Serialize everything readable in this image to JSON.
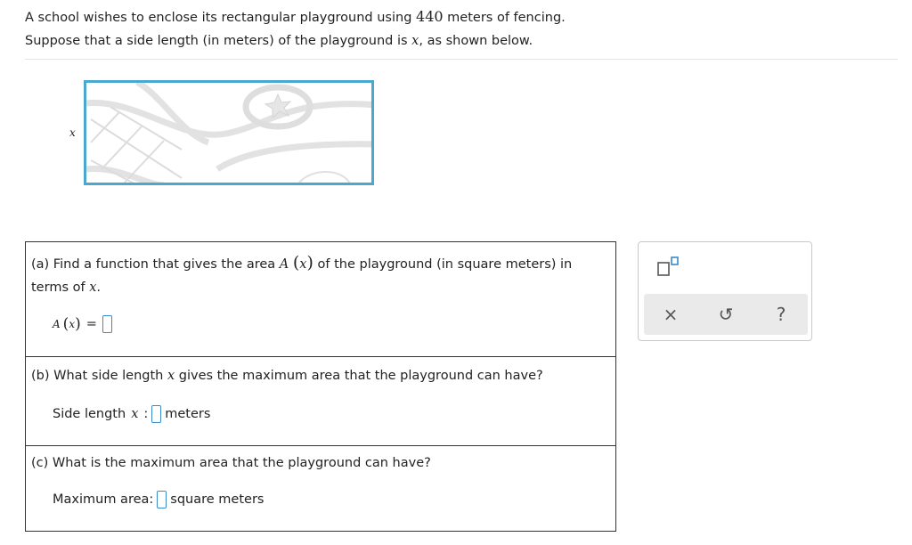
{
  "intro": {
    "line1_a": "A school wishes to enclose its rectangular playground using",
    "fencing_length": "440",
    "line1_b": "meters of fencing.",
    "line2_a": "Suppose that a side length (in meters) of the playground is",
    "var_x": "x",
    "line2_b": ", as shown below."
  },
  "figure": {
    "side_label": "x"
  },
  "part_a": {
    "q_a": "(a) Find a function that gives the area",
    "func": "A",
    "paren_open": "(",
    "var": "x",
    "paren_close": ")",
    "q_b": "of the playground (in square meters) in",
    "q_c": "terms of",
    "var2": "x",
    "period": ".",
    "ans_func": "A",
    "ans_var": "x",
    "equals": "="
  },
  "part_b": {
    "q_a": "(b) What side length",
    "var": "x",
    "q_b": "gives the maximum area that the playground can have?",
    "ans_label": "Side length",
    "ans_var": "x",
    "colon": ":",
    "unit": "meters"
  },
  "part_c": {
    "question": "(c) What is the maximum area that the playground can have?",
    "ans_label": "Maximum area:",
    "unit": "square meters"
  },
  "toolbox": {
    "clear": "×",
    "undo": "↺",
    "help": "?"
  },
  "colors": {
    "accent": "#3a8bc9",
    "figure_border": "#4aa8d0"
  }
}
